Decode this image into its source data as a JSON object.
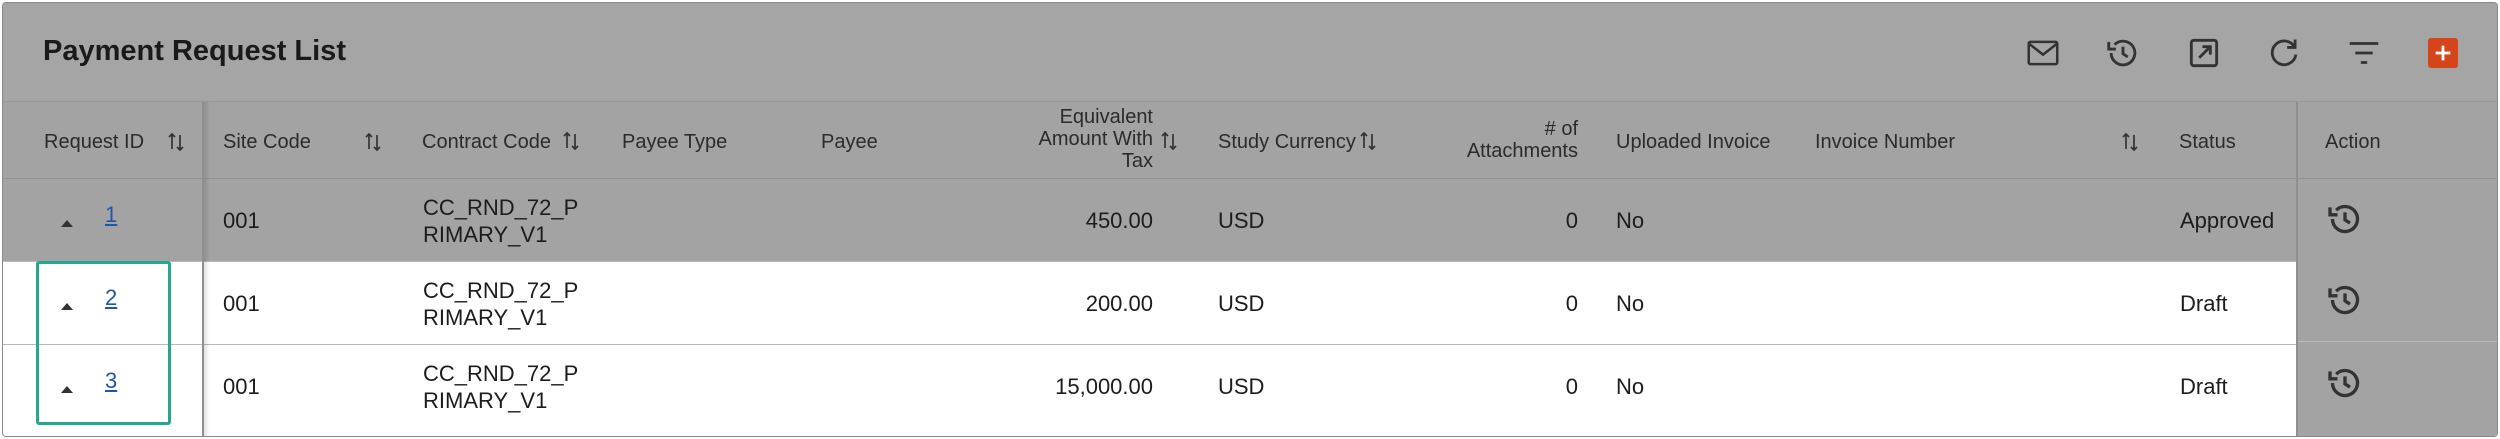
{
  "title": "Payment Request List",
  "toolbar": {
    "icons": [
      "mail-icon",
      "history-icon",
      "open-external-icon",
      "refresh-icon",
      "filter-icon",
      "add-icon"
    ],
    "accent_color": "#d6451a"
  },
  "columns": {
    "request_id": "Request ID",
    "site_code": "Site Code",
    "contract_code": "Contract Code",
    "payee_type": "Payee Type",
    "payee": "Payee",
    "equiv_amount_l1": "Equivalent",
    "equiv_amount_l2": "Amount With",
    "equiv_amount_l3": "Tax",
    "study_currency": "Study Currency",
    "attachments_l1": "# of",
    "attachments_l2": "Attachments",
    "uploaded_invoice": "Uploaded Invoice",
    "invoice_number": "Invoice Number",
    "status": "Status",
    "action": "Action"
  },
  "rows": [
    {
      "id": "1",
      "site": "001",
      "contract_l1": "CC_RND_72_P",
      "contract_l2": "RIMARY_V1",
      "amount": "450.00",
      "currency": "USD",
      "attachments": "0",
      "uploaded": "No",
      "status": "Approved"
    },
    {
      "id": "2",
      "site": "001",
      "contract_l1": "CC_RND_72_P",
      "contract_l2": "RIMARY_V1",
      "amount": "200.00",
      "currency": "USD",
      "attachments": "0",
      "uploaded": "No",
      "status": "Draft"
    },
    {
      "id": "3",
      "site": "001",
      "contract_l1": "CC_RND_72_P",
      "contract_l2": "RIMARY_V1",
      "amount": "15,000.00",
      "currency": "USD",
      "attachments": "0",
      "uploaded": "No",
      "status": "Draft"
    }
  ]
}
